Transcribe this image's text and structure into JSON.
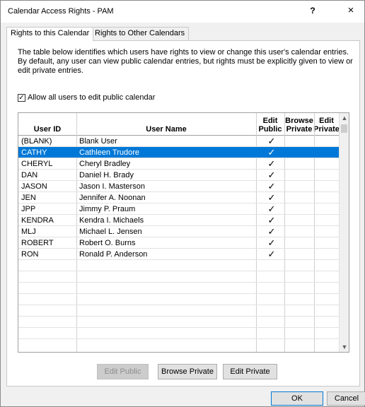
{
  "window": {
    "title": "Calendar Access Rights - PAM",
    "help_label": "?",
    "close_label": "×"
  },
  "tabs": [
    {
      "label": "Rights to this Calendar",
      "active": true
    },
    {
      "label": "Rights to Other Calendars",
      "active": false
    }
  ],
  "description": "The table below identifies which users have rights to view or change this user's calendar entries.  By default, any user can view public calendar entries, but rights must be explicitly given to view or edit private entries.",
  "allow_all": {
    "checked": true,
    "check_mark": "✓",
    "label": "Allow all users to edit public calendar"
  },
  "table": {
    "columns": {
      "user_id": "User ID",
      "user_name": "User Name",
      "edit_public": "Edit Public",
      "browse_private": "Browse Private",
      "edit_private": "Edit Private"
    },
    "check_glyph": "✓",
    "rows": [
      {
        "user_id": "(BLANK)",
        "user_name": "Blank User",
        "edit_public": true,
        "browse_private": false,
        "edit_private": false
      },
      {
        "user_id": "CATHY",
        "user_name": "Cathleen Trudore",
        "edit_public": true,
        "browse_private": false,
        "edit_private": false,
        "selected": true
      },
      {
        "user_id": "CHERYL",
        "user_name": "Cheryl Bradley",
        "edit_public": true,
        "browse_private": false,
        "edit_private": false
      },
      {
        "user_id": "DAN",
        "user_name": "Daniel H. Brady",
        "edit_public": true,
        "browse_private": false,
        "edit_private": false
      },
      {
        "user_id": "JASON",
        "user_name": "Jason I. Masterson",
        "edit_public": true,
        "browse_private": false,
        "edit_private": false
      },
      {
        "user_id": "JEN",
        "user_name": "Jennifer A. Noonan",
        "edit_public": true,
        "browse_private": false,
        "edit_private": false
      },
      {
        "user_id": "JPP",
        "user_name": "Jimmy P. Praum",
        "edit_public": true,
        "browse_private": false,
        "edit_private": false
      },
      {
        "user_id": "KENDRA",
        "user_name": "Kendra I. Michaels",
        "edit_public": true,
        "browse_private": false,
        "edit_private": false
      },
      {
        "user_id": "MLJ",
        "user_name": "Michael L. Jensen",
        "edit_public": true,
        "browse_private": false,
        "edit_private": false
      },
      {
        "user_id": "ROBERT",
        "user_name": "Robert O. Burns",
        "edit_public": true,
        "browse_private": false,
        "edit_private": false
      },
      {
        "user_id": "RON",
        "user_name": "Ronald P. Anderson",
        "edit_public": true,
        "browse_private": false,
        "edit_private": false
      }
    ],
    "empty_rows": 7
  },
  "buttons": {
    "edit_public": {
      "label": "Edit Public",
      "enabled": false
    },
    "browse_private": {
      "label": "Browse Private",
      "enabled": true
    },
    "edit_private": {
      "label": "Edit Private",
      "enabled": true
    },
    "ok": {
      "label": "OK"
    },
    "cancel": {
      "label": "Cancel"
    }
  },
  "colors": {
    "selection": "#0078d7",
    "dialog_background": "#f0f0f0"
  }
}
